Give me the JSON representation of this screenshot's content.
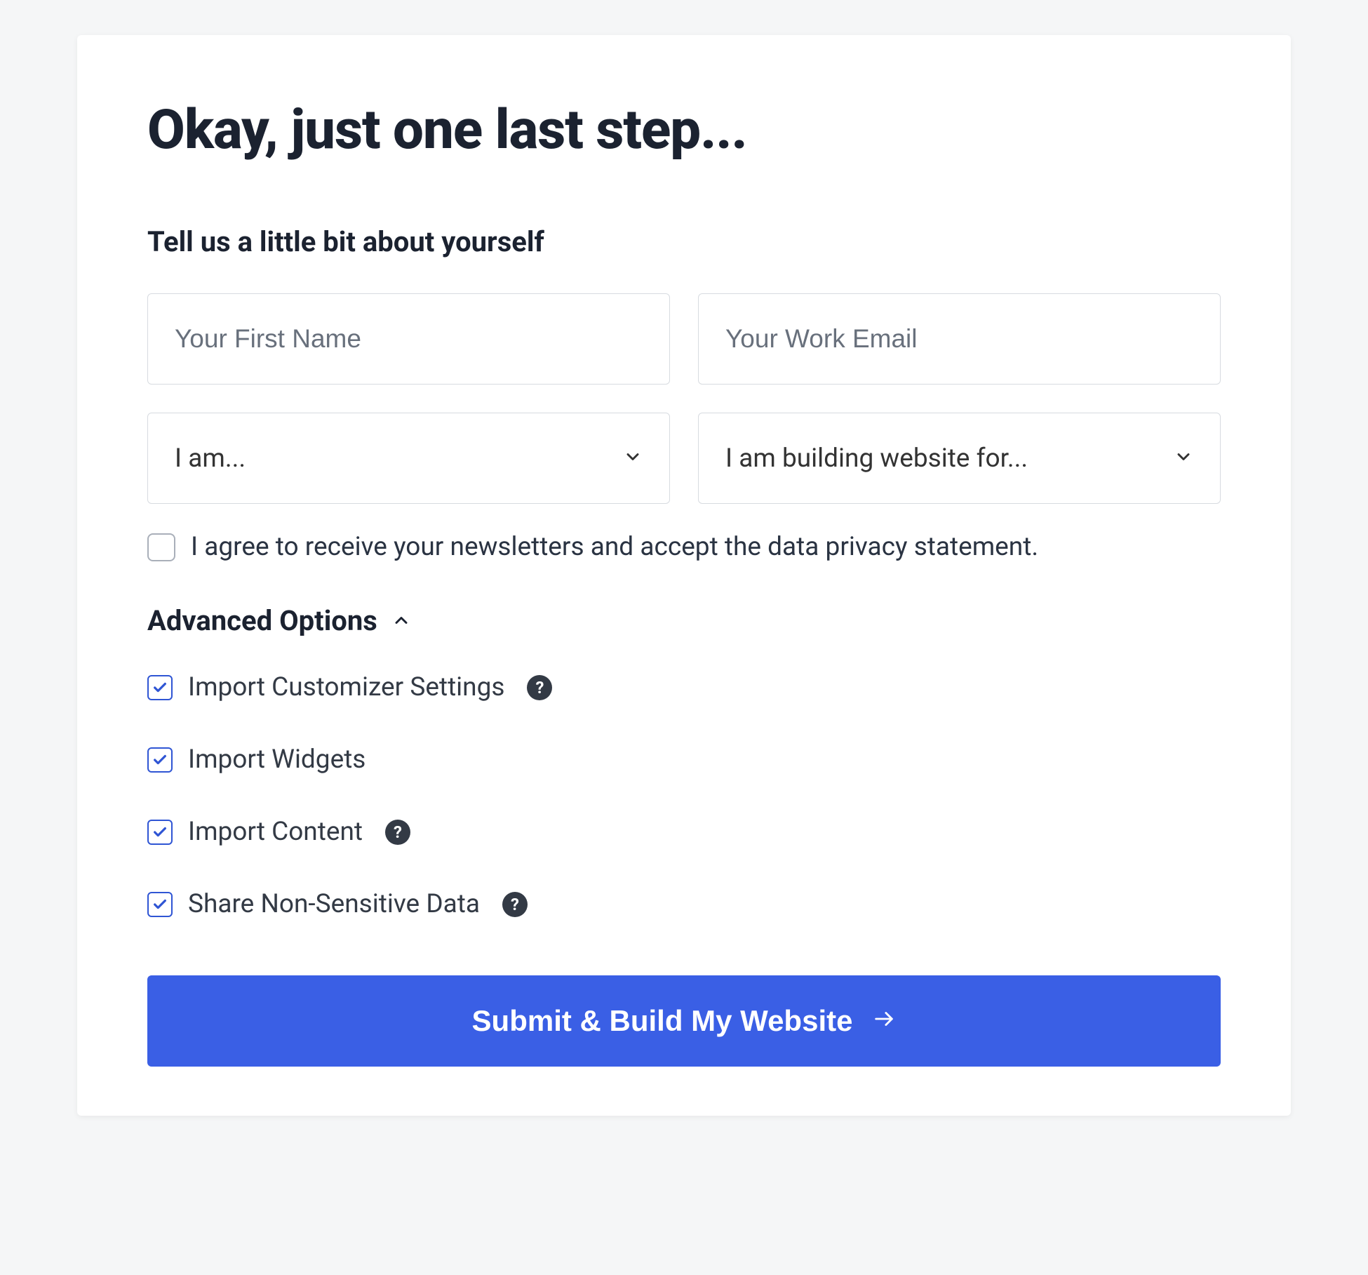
{
  "heading": "Okay, just one last step...",
  "subtitle": "Tell us a little bit about yourself",
  "fields": {
    "first_name_placeholder": "Your First Name",
    "email_placeholder": "Your Work Email",
    "role_placeholder": "I am...",
    "building_for_placeholder": "I am building website for..."
  },
  "consent_label": "I agree to receive your newsletters and accept the data privacy statement.",
  "advanced_label": "Advanced Options",
  "options": [
    {
      "label": "Import Customizer Settings",
      "help": true
    },
    {
      "label": "Import Widgets",
      "help": false
    },
    {
      "label": "Import Content",
      "help": true
    },
    {
      "label": "Share Non-Sensitive Data",
      "help": true
    }
  ],
  "submit_label": "Submit & Build My Website",
  "help_glyph": "?"
}
